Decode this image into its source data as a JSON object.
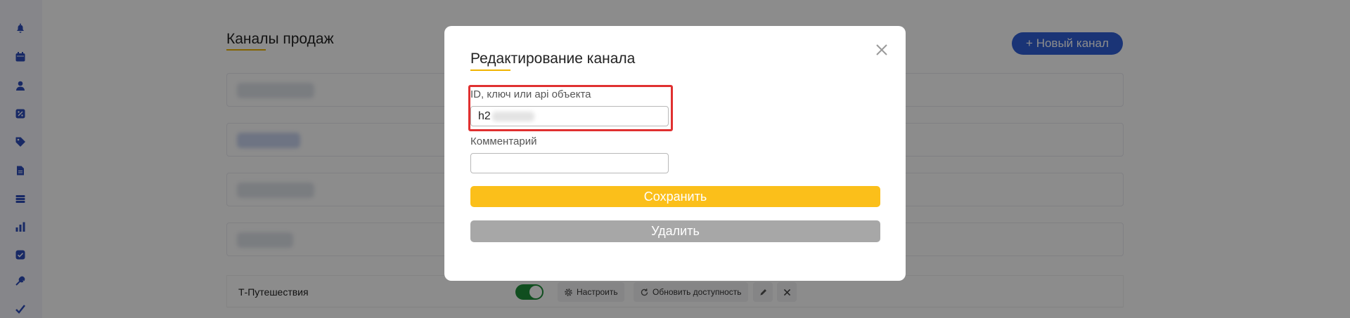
{
  "sidebar": {
    "icons": [
      "bell-icon",
      "calendar-icon",
      "user-icon",
      "percent-icon",
      "tag-icon",
      "document-icon",
      "layers-icon",
      "bar-chart-icon",
      "checkbox-icon",
      "tools-icon",
      "checkmark-icon"
    ]
  },
  "page": {
    "title": "Каналы продаж",
    "new_channel_button": "+ Новый канал",
    "last_row": {
      "name": "Т-Путешествия",
      "configure_label": "Настроить",
      "refresh_label": "Обновить доступность",
      "enabled": true
    }
  },
  "modal": {
    "title": "Редактирование канала",
    "fields": {
      "id_label": "ID, ключ или api объекта",
      "id_value": "h2",
      "comment_label": "Комментарий",
      "comment_value": ""
    },
    "save_label": "Сохранить",
    "delete_label": "Удалить"
  },
  "colors": {
    "accent_yellow": "#fbbf1a",
    "brand_blue": "#3060d8",
    "delete_gray": "#a7a7a7",
    "highlight_red": "#e03030",
    "toggle_green": "#1e8f3a"
  }
}
